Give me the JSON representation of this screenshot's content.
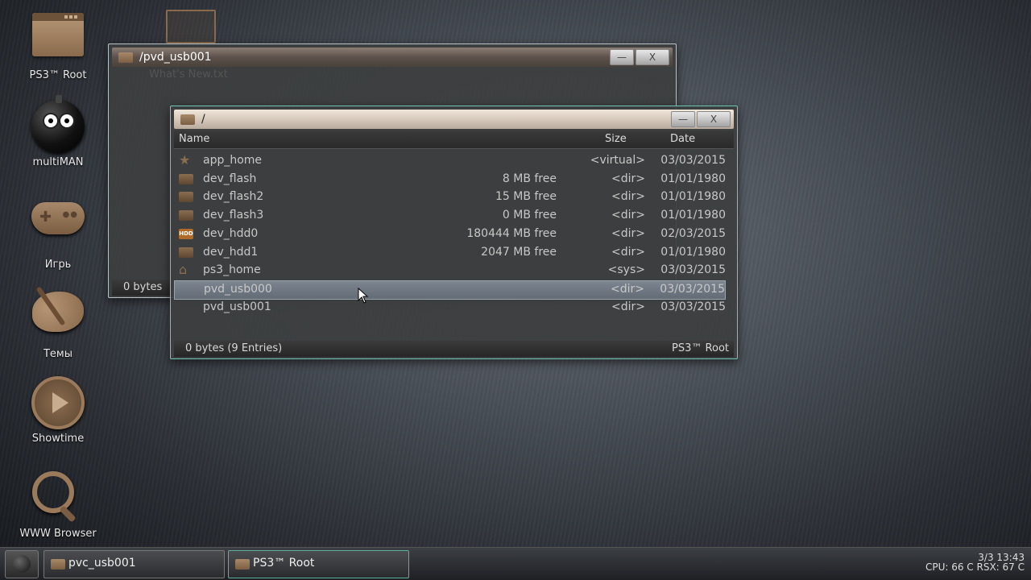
{
  "desktop": {
    "icons": [
      {
        "label": "PS3™ Root",
        "icon": "folder-icon"
      },
      {
        "label": "multiMAN",
        "icon": "bomb-icon"
      },
      {
        "label": "Игрь",
        "icon": "gamepad-icon"
      },
      {
        "label": "Темы",
        "icon": "palette-icon"
      },
      {
        "label": "Showtime",
        "icon": "play-icon"
      },
      {
        "label": "WWW Browser",
        "icon": "magnifier-icon"
      }
    ]
  },
  "back_window": {
    "title": "/pvd_usb001",
    "ghost_text": "What's New.txt",
    "status_left": "0 bytes",
    "minimize_label": "—",
    "close_label": "X"
  },
  "front_window": {
    "title": "/",
    "minimize_label": "—",
    "close_label": "X",
    "columns": {
      "name": "Name",
      "size": "Size",
      "date": "Date"
    },
    "rows": [
      {
        "name": "app_home",
        "size": "",
        "type": "<virtual>",
        "date": "03/03/2015",
        "icon": "star-icon"
      },
      {
        "name": "dev_flash",
        "size": "8 MB free",
        "type": "<dir>",
        "date": "01/01/1980",
        "icon": "folder-icon"
      },
      {
        "name": "dev_flash2",
        "size": "15 MB free",
        "type": "<dir>",
        "date": "01/01/1980",
        "icon": "folder-icon"
      },
      {
        "name": "dev_flash3",
        "size": "0 MB free",
        "type": "<dir>",
        "date": "01/01/1980",
        "icon": "folder-icon"
      },
      {
        "name": "dev_hdd0",
        "size": "180444 MB free",
        "type": "<dir>",
        "date": "02/03/2015",
        "icon": "hdd-icon"
      },
      {
        "name": "dev_hdd1",
        "size": "2047 MB free",
        "type": "<dir>",
        "date": "01/01/1980",
        "icon": "folder-icon"
      },
      {
        "name": "ps3_home",
        "size": "",
        "type": "<sys>",
        "date": "03/03/2015",
        "icon": "home-icon"
      },
      {
        "name": "pvd_usb000",
        "size": "",
        "type": "<dir>",
        "date": "03/03/2015",
        "icon": "",
        "selected": true
      },
      {
        "name": "pvd_usb001",
        "size": "",
        "type": "<dir>",
        "date": "03/03/2015",
        "icon": ""
      }
    ],
    "status_left": "0 bytes (9 Entries)",
    "status_right": "PS3™ Root"
  },
  "taskbar": {
    "items": [
      {
        "label": "pvc_usb001",
        "active": false
      },
      {
        "label": "PS3™ Root",
        "active": true
      }
    ],
    "clock": "3/3 13:43",
    "temps": "CPU: 66 C RSX: 67 C"
  },
  "colors": {
    "selection": "#6f7883",
    "folder": "#8a6d50",
    "active_task_border": "#5ab09a"
  }
}
